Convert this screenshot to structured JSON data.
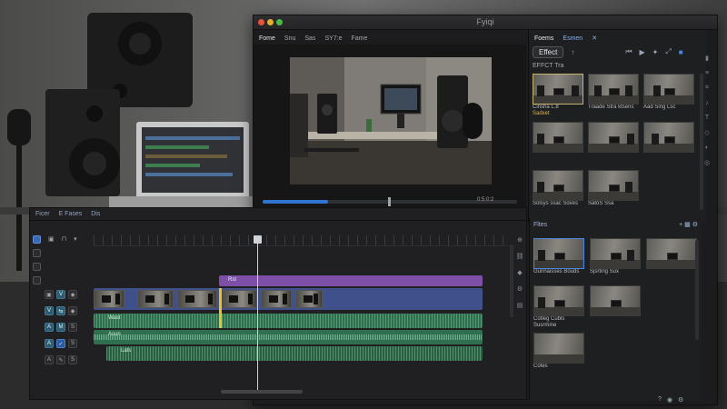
{
  "window": {
    "title": "Fyiqi"
  },
  "monitor": {
    "tabs": [
      "Fome",
      "Snu",
      "Sas",
      "SY7:e",
      "Fame"
    ],
    "timecode": "0:5:0:2",
    "transport_icons": [
      "mark-in-icon",
      "step-back-icon",
      "rewind-icon",
      "play-icon",
      "forward-icon",
      "loop-icon",
      "export-icon"
    ]
  },
  "effects": {
    "tabs": [
      "Foems",
      "Esmen"
    ],
    "pill_label": "Effect",
    "section_label": "EFFCT Tra",
    "items": [
      {
        "caption": "Cinsha L.8",
        "highlight": "Sadxet",
        "selected": true
      },
      {
        "caption": "Traade Stra ktsens",
        "highlight": ""
      },
      {
        "caption": "Aad Sing Lsc",
        "highlight": ""
      },
      {
        "caption": "",
        "highlight": ""
      },
      {
        "caption": "",
        "highlight": ""
      },
      {
        "caption": "",
        "highlight": ""
      },
      {
        "caption": "Solsys ssac Soves",
        "highlight": ""
      },
      {
        "caption": "SatoS Ssa",
        "highlight": ""
      }
    ]
  },
  "timeline": {
    "tabs": [
      "Ficer",
      "E Fases",
      "Dis"
    ],
    "tools": [
      "selection-tool",
      "razor-tool",
      "ripple-tool",
      "hand-tool"
    ],
    "purple_clip_label": "Rst",
    "audio_label_1": "Wast",
    "audio_label_2": "Asun",
    "audio_label_3": "Lats"
  },
  "files": {
    "title": "Fltes",
    "items": [
      {
        "caption": "Gunnaisses Bouds",
        "selected": true
      },
      {
        "caption": "Sjsrting Sux"
      },
      {
        "caption": ""
      },
      {
        "caption": "Cotleg Cubls Susrmine"
      },
      {
        "caption": ""
      },
      {
        "caption": "Cotes"
      }
    ]
  },
  "colors": {
    "accent_blue": "#2f74d0",
    "clip_purple": "#7e4fa6",
    "video_track": "#40508a",
    "audio_track": "#2f6e4e",
    "in_point_yellow": "#e6c22b"
  }
}
